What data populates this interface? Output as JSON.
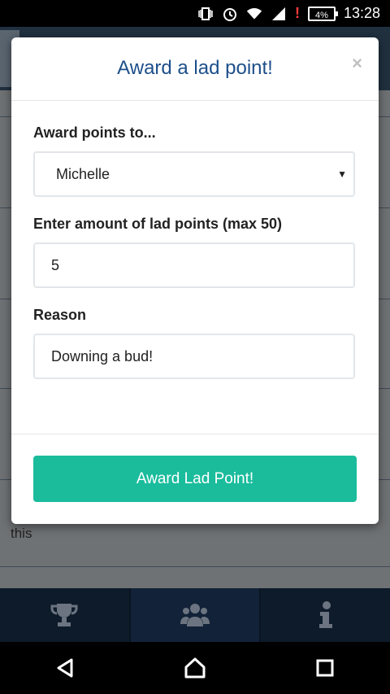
{
  "status_bar": {
    "time": "13:28",
    "battery": "4%"
  },
  "background": {
    "partial_text": "this"
  },
  "modal": {
    "title": "Award a lad point!",
    "close_label": "×",
    "recipient_label": "Award points to...",
    "recipient_value": "Michelle",
    "amount_label": "Enter amount of lad points (max 50)",
    "amount_value": "5",
    "reason_label": "Reason",
    "reason_value": "Downing a bud!",
    "submit_label": "Award Lad Point!"
  },
  "tabbar": {
    "tabs": [
      {
        "icon": "trophy-icon"
      },
      {
        "icon": "users-icon"
      },
      {
        "icon": "info-icon"
      }
    ]
  },
  "colors": {
    "accent": "#1abc9c",
    "title": "#1d4f8a"
  }
}
